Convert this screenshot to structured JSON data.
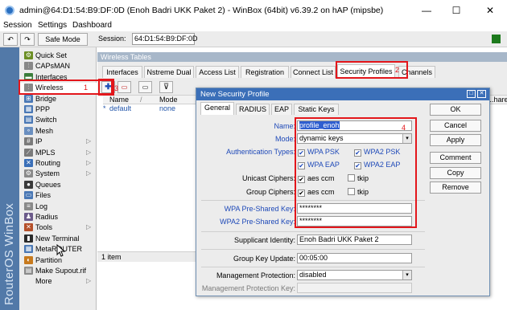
{
  "window": {
    "title": "admin@64:D1:54:B9:DF:0D (Enoh Badri UKK Paket 2) - WinBox (64bit) v6.39.2 on hAP (mipsbe)",
    "minimize": "—",
    "maximize": "☐",
    "close": "✕"
  },
  "menu": {
    "session": "Session",
    "settings": "Settings",
    "dashboard": "Dashboard"
  },
  "toolbar": {
    "undo_icon": "↶",
    "redo_icon": "↷",
    "safe_mode": "Safe Mode",
    "session_label": "Session:",
    "session_value": "64:D1:54:B9:DF:0D"
  },
  "brand": "RouterOS WinBox",
  "sidebar": {
    "items": [
      {
        "label": "Quick Set",
        "icon": "quick-set-icon",
        "glyph": "⚙",
        "color": "#6b8e23"
      },
      {
        "label": "CAPsMAN",
        "icon": "capsman-icon",
        "glyph": "⫶",
        "color": "#888888"
      },
      {
        "label": "Interfaces",
        "icon": "interfaces-icon",
        "glyph": "▬",
        "color": "#3a7d3a"
      },
      {
        "label": "Wireless",
        "icon": "wireless-icon",
        "glyph": "⫶",
        "color": "#888888"
      },
      {
        "label": "Bridge",
        "icon": "bridge-icon",
        "glyph": "⊞",
        "color": "#4a78b5"
      },
      {
        "label": "PPP",
        "icon": "ppp-icon",
        "glyph": "▦",
        "color": "#4a78b5"
      },
      {
        "label": "Switch",
        "icon": "switch-icon",
        "glyph": "▤",
        "color": "#4a78b5"
      },
      {
        "label": "Mesh",
        "icon": "mesh-icon",
        "glyph": "∘",
        "color": "#6a8fc0"
      },
      {
        "label": "IP",
        "icon": "ip-icon",
        "glyph": "#",
        "color": "#7a7a7a",
        "arrow": true
      },
      {
        "label": "MPLS",
        "icon": "mpls-icon",
        "glyph": "⟋",
        "color": "#7a7a7a",
        "arrow": true
      },
      {
        "label": "Routing",
        "icon": "routing-icon",
        "glyph": "✕",
        "color": "#3a6fb8",
        "arrow": true
      },
      {
        "label": "System",
        "icon": "system-icon",
        "glyph": "⚙",
        "color": "#8a8a8a",
        "arrow": true
      },
      {
        "label": "Queues",
        "icon": "queues-icon",
        "glyph": "●",
        "color": "#3a3a3a"
      },
      {
        "label": "Files",
        "icon": "files-icon",
        "glyph": "▭",
        "color": "#4a78b5"
      },
      {
        "label": "Log",
        "icon": "log-icon",
        "glyph": "≡",
        "color": "#8a8a8a"
      },
      {
        "label": "Radius",
        "icon": "radius-icon",
        "glyph": "♟",
        "color": "#6b5a8a"
      },
      {
        "label": "Tools",
        "icon": "tools-icon",
        "glyph": "✕",
        "color": "#b5502a",
        "arrow": true
      },
      {
        "label": "New Terminal",
        "icon": "terminal-icon",
        "glyph": "▮",
        "color": "#2a2a2a"
      },
      {
        "label": "MetaROUTER",
        "icon": "metarouter-icon",
        "glyph": "▦",
        "color": "#4a78b5"
      },
      {
        "label": "Partition",
        "icon": "partition-icon",
        "glyph": "◐",
        "color": "#c77a1e"
      },
      {
        "label": "Make Supout.rif",
        "icon": "supout-icon",
        "glyph": "▤",
        "color": "#8a8a8a"
      },
      {
        "label": "More",
        "icon": "more-icon",
        "glyph": "",
        "color": "transparent",
        "arrow": true
      }
    ]
  },
  "wireless_tables": {
    "title": "Wireless Tables",
    "tabs": [
      "Interfaces",
      "Nstreme Dual",
      "Access List",
      "Registration",
      "Connect List",
      "Security Profiles",
      "Channels"
    ],
    "active_tab": "Security Profiles",
    "columns": [
      "Name",
      "Mode",
      "...hared"
    ],
    "rows": [
      {
        "marker": "*",
        "name": "default",
        "mode": "none"
      }
    ],
    "footer": "1 item"
  },
  "dialog": {
    "title": "New Security Profile",
    "tabs": [
      "General",
      "RADIUS",
      "EAP",
      "Static Keys"
    ],
    "active_tab": "General",
    "fields": {
      "name_label": "Name:",
      "name_value": "profile_enoh",
      "mode_label": "Mode:",
      "mode_value": "dynamic keys",
      "auth_label": "Authentication Types:",
      "auth": [
        {
          "label": "WPA PSK",
          "checked": true
        },
        {
          "label": "WPA2 PSK",
          "checked": true
        },
        {
          "label": "WPA EAP",
          "checked": true
        },
        {
          "label": "WPA2 EAP",
          "checked": true
        }
      ],
      "unicast_label": "Unicast Ciphers:",
      "unicast": [
        {
          "label": "aes ccm",
          "checked": true
        },
        {
          "label": "tkip",
          "checked": false
        }
      ],
      "group_label": "Group Ciphers:",
      "group": [
        {
          "label": "aes ccm",
          "checked": true
        },
        {
          "label": "tkip",
          "checked": false
        }
      ],
      "wpa_key_label": "WPA Pre-Shared Key:",
      "wpa_key_value": "********",
      "wpa2_key_label": "WPA2 Pre-Shared Key:",
      "wpa2_key_value": "********",
      "supplicant_label": "Supplicant Identity:",
      "supplicant_value": "Enoh Badri UKK Paket 2",
      "group_update_label": "Group Key Update:",
      "group_update_value": "00:05:00",
      "mgmt_label": "Management Protection:",
      "mgmt_value": "disabled",
      "mgmt_key_label": "Management Protection Key:",
      "mgmt_key_value": ""
    },
    "buttons": [
      "OK",
      "Cancel",
      "Apply",
      "Comment",
      "Copy",
      "Remove"
    ]
  },
  "annotations": [
    "1",
    "2",
    "3",
    "4"
  ],
  "colors": {
    "annotation_red": "#e3161b",
    "dialog_title": "#3b6fb8",
    "brand_strip": "#5279a8",
    "label_blue": "#1e49b8"
  }
}
